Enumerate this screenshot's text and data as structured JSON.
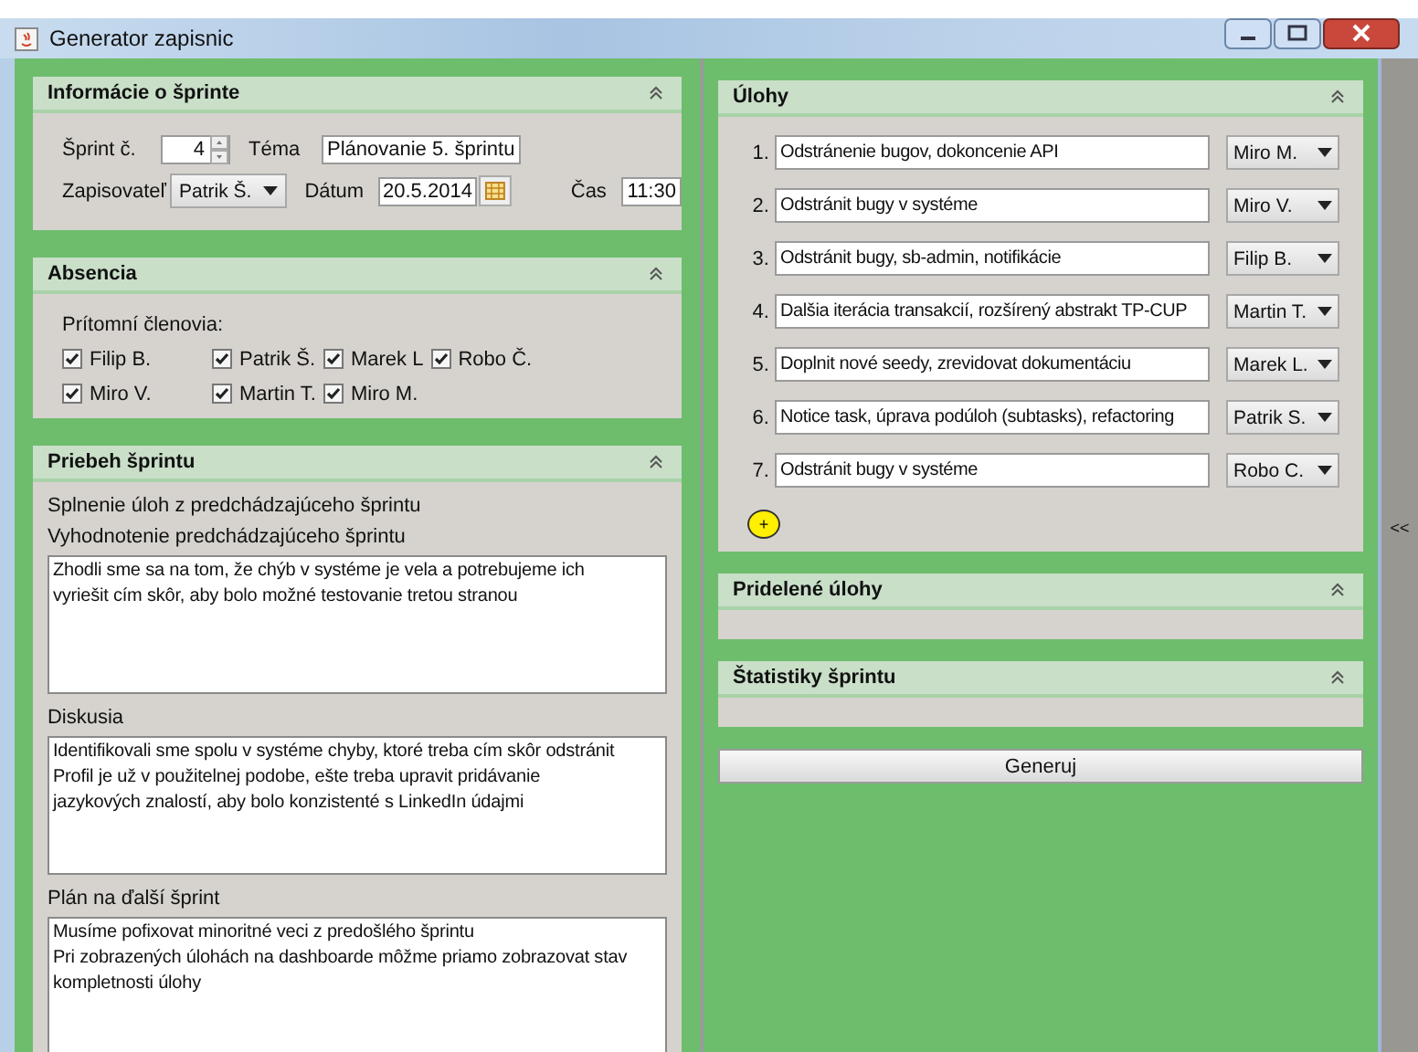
{
  "window": {
    "title": "Generator zapisnic"
  },
  "info": {
    "title": "Informácie o šprinte",
    "sprint_label": "Šprint č.",
    "sprint_value": "4",
    "topic_label": "Téma",
    "topic_value": "Plánovanie 5. šprintu",
    "writer_label": "Zapisovateľ",
    "writer_value": "Patrik Š.",
    "date_label": "Dátum",
    "date_value": "20.5.2014",
    "time_label": "Čas",
    "time_value": "11:30"
  },
  "absence": {
    "title": "Absencia",
    "label": "Prítomní členovia:",
    "members": [
      {
        "name": "Filip B.",
        "checked": true
      },
      {
        "name": "Patrik Š.",
        "checked": true
      },
      {
        "name": "Marek L",
        "checked": true
      },
      {
        "name": "Robo Č.",
        "checked": true
      },
      {
        "name": "Miro V.",
        "checked": true
      },
      {
        "name": "Martin T.",
        "checked": true
      },
      {
        "name": "Miro M.",
        "checked": true
      }
    ]
  },
  "progress": {
    "title": "Priebeh šprintu",
    "subtitle": "Splnenie úloh z predchádzajúceho šprintu",
    "fields": [
      {
        "label": "Vyhodnotenie predchádzajúceho šprintu",
        "lines": [
          "Zhodli sme sa na tom, že chýb v systéme je vela a potrebujeme ich",
          "vyriešit cím skôr, aby bolo možné testovanie tretou stranou"
        ]
      },
      {
        "label": "Diskusia",
        "lines": [
          "Identifikovali sme spolu v systéme chyby, ktoré treba cím skôr odstránit",
          "Profil je už v použitelnej podobe, ešte treba upravit pridávanie",
          "jazykových znalostí, aby bolo konzistenté s LinkedIn údajmi"
        ]
      },
      {
        "label": "Plán na ďalší šprint",
        "lines": [
          "Musíme pofixovat minoritné veci z predošlého šprintu",
          "Pri zobrazených úlohách na dashboarde môžme priamo zobrazovat stav",
          "kompletnosti úlohy"
        ]
      }
    ]
  },
  "tasks": {
    "title": "Úlohy",
    "add_label": "+",
    "items": [
      {
        "number": "1.",
        "text": "Odstránenie bugov, dokoncenie API",
        "assignee": "Miro M."
      },
      {
        "number": "2.",
        "text": "Odstránit bugy v systéme",
        "assignee": "Miro V."
      },
      {
        "number": "3.",
        "text": "Odstránit bugy, sb-admin, notifikácie",
        "assignee": "Filip B."
      },
      {
        "number": "4.",
        "text": "Dalšia iterácia transakcií, rozšírený abstrakt TP-CUP",
        "assignee": "Martin T."
      },
      {
        "number": "5.",
        "text": "Doplnit nové seedy, zrevidovat dokumentáciu",
        "assignee": "Marek L."
      },
      {
        "number": "6.",
        "text": "Notice task, úprava podúloh (subtasks), refactoring",
        "assignee": "Patrik S."
      },
      {
        "number": "7.",
        "text": "Odstránit bugy v systéme",
        "assignee": "Robo C."
      }
    ]
  },
  "assigned": {
    "title": "Pridelené úlohy"
  },
  "stats": {
    "title": "Štatistiky šprintu"
  },
  "generate_button": "Generuj",
  "side_toggle": "<<"
}
